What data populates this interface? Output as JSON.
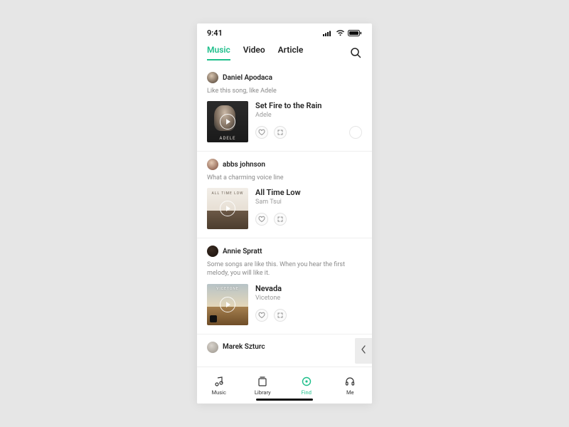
{
  "statusbar": {
    "time": "9:41"
  },
  "tabs": {
    "items": [
      {
        "label": "Music",
        "active": true
      },
      {
        "label": "Video",
        "active": false
      },
      {
        "label": "Article",
        "active": false
      }
    ]
  },
  "posts": [
    {
      "user": "Daniel Apodaca",
      "caption": "Like this song, like Adele",
      "track_title": "Set Fire to the Rain",
      "track_artist": "Adele",
      "cover_label": "ADELE"
    },
    {
      "user": "abbs johnson",
      "caption": "What a charming voice line",
      "track_title": "All Time Low",
      "track_artist": "Sam Tsui",
      "cover_label": "ALL TIME LOW"
    },
    {
      "user": "Annie Spratt",
      "caption": "Some songs are like this. When you hear the first melody, you will like it.",
      "track_title": "Nevada",
      "track_artist": "Vicetone",
      "cover_label": "VICETONE"
    },
    {
      "user": "Marek Szturc"
    }
  ],
  "bottomnav": {
    "items": [
      {
        "label": "Music",
        "active": false
      },
      {
        "label": "Library",
        "active": false
      },
      {
        "label": "Find",
        "active": true
      },
      {
        "label": "Me",
        "active": false
      }
    ]
  },
  "colors": {
    "accent": "#1fbf8b"
  }
}
